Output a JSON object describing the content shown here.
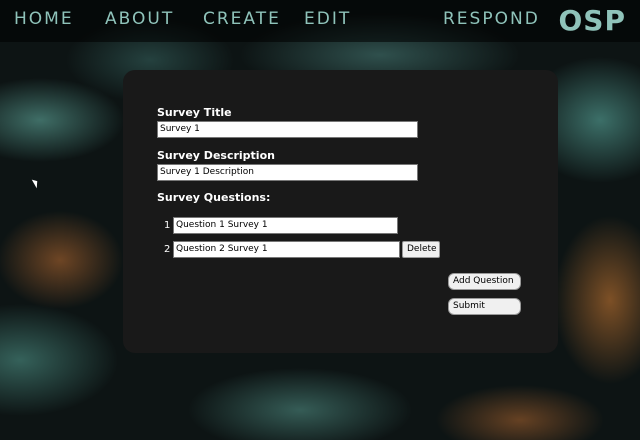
{
  "nav": {
    "home": "HOME",
    "about": "ABOUT",
    "create": "CREATE",
    "edit": "EDIT",
    "respond": "RESPOND",
    "logo": "OSP"
  },
  "form": {
    "title_label": "Survey Title",
    "title_value": "Survey 1",
    "description_label": "Survey Description",
    "description_value": "Survey 1 Description",
    "questions_label": "Survey Questions:",
    "questions": [
      {
        "number": "1",
        "value": "Question 1 Survey 1"
      },
      {
        "number": "2",
        "value": "Question 2 Survey 1"
      }
    ],
    "delete_label": "Delete",
    "add_question_label": "Add Question",
    "submit_label": "Submit"
  },
  "colors": {
    "nav_text": "#8fc3ba",
    "panel_bg": "#191919"
  }
}
